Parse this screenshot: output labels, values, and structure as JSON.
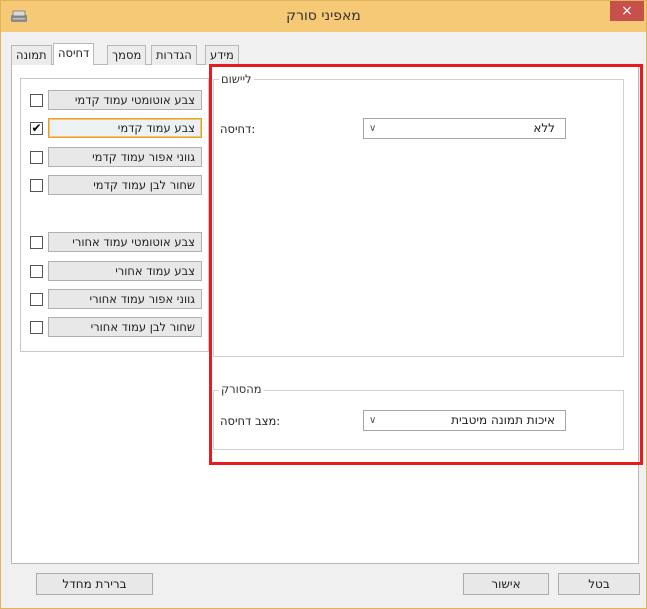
{
  "window": {
    "title": "מאפיני סורק",
    "close_glyph": "×",
    "colors": {
      "titlebar": "#f6c976",
      "close": "#c7504c",
      "highlight": "#e8191f"
    }
  },
  "tabs": [
    {
      "label": "תמונה"
    },
    {
      "label": "דחיסה",
      "active": true
    },
    {
      "label": "מסמך"
    },
    {
      "label": "הגדרות"
    },
    {
      "label": "מידע"
    }
  ],
  "options": {
    "front": [
      {
        "label": "צבע אוטומטי עמוד קדמי",
        "checked": false
      },
      {
        "label": "צבע עמוד קדמי",
        "checked": true
      },
      {
        "label": "גווני אפור עמוד קדמי",
        "checked": false
      },
      {
        "label": "שחור לבן עמוד קדמי",
        "checked": false
      }
    ],
    "back": [
      {
        "label": "צבע אוטומטי עמוד אחורי",
        "checked": false
      },
      {
        "label": "צבע עמוד אחורי",
        "checked": false
      },
      {
        "label": "גווני אפור עמוד אחורי",
        "checked": false
      },
      {
        "label": "שחור לבן עמוד אחורי",
        "checked": false
      }
    ],
    "check_glyph": "✔"
  },
  "software_group": {
    "title": "ליישום",
    "compression_label": ":דחיסה",
    "compression_value": "ללא"
  },
  "scanner_group": {
    "title": "מהסורק",
    "mode_label": ":מצב דחיסה",
    "mode_value": "איכות תמונה מיטבית"
  },
  "footer": {
    "default_label": "ברירת מחדל",
    "ok_label": "אישור",
    "cancel_label": "בטל"
  },
  "icons": {
    "app": "scanner-icon",
    "dropdown": "chevron-down-icon"
  }
}
